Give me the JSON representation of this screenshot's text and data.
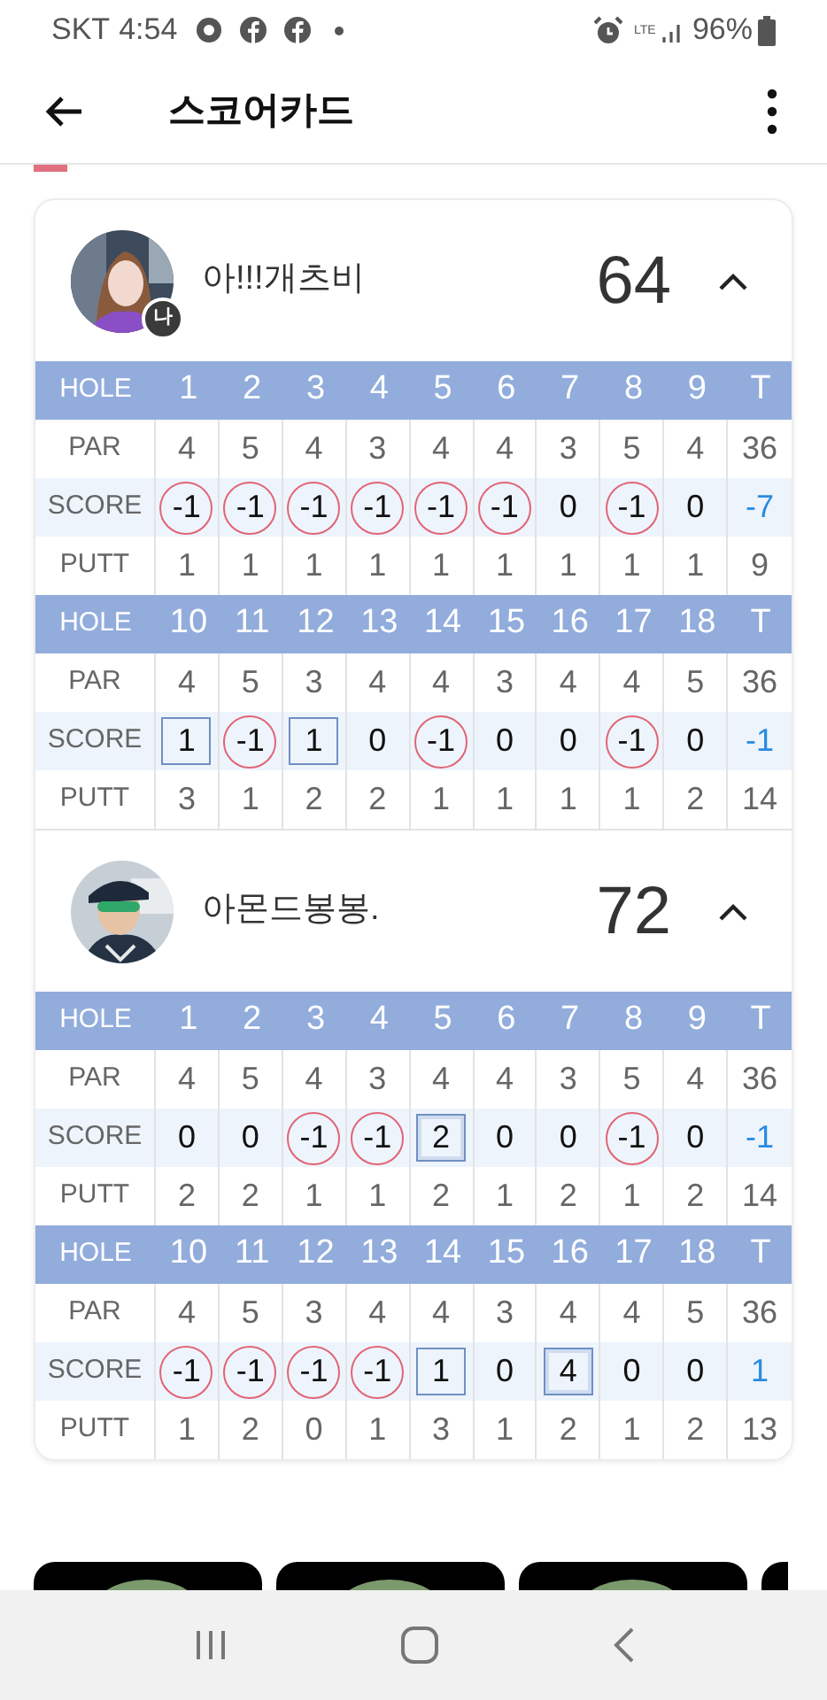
{
  "status_bar": {
    "carrier": "SKT",
    "time": "4:54",
    "network": "LTE",
    "battery": "96%"
  },
  "app_bar": {
    "title": "스코어카드"
  },
  "players": [
    {
      "name": "아!!!개츠비",
      "total": "64",
      "badge": "나",
      "expanded": true,
      "nines": [
        {
          "labels": [
            "HOLE",
            "PAR",
            "SCORE",
            "PUTT"
          ],
          "holes": [
            "1",
            "2",
            "3",
            "4",
            "5",
            "6",
            "7",
            "8",
            "9",
            "T"
          ],
          "par": [
            "4",
            "5",
            "4",
            "3",
            "4",
            "4",
            "3",
            "5",
            "4",
            "36"
          ],
          "scores": [
            {
              "value": "-1",
              "kind": "circle"
            },
            {
              "value": "-1",
              "kind": "circle"
            },
            {
              "value": "-1",
              "kind": "circle"
            },
            {
              "value": "-1",
              "kind": "circle"
            },
            {
              "value": "-1",
              "kind": "circle"
            },
            {
              "value": "-1",
              "kind": "circle"
            },
            {
              "value": "0",
              "kind": "plain"
            },
            {
              "value": "-1",
              "kind": "circle"
            },
            {
              "value": "0",
              "kind": "plain"
            }
          ],
          "score_total": "-7",
          "putt": [
            "1",
            "1",
            "1",
            "1",
            "1",
            "1",
            "1",
            "1",
            "1",
            "9"
          ]
        },
        {
          "labels": [
            "HOLE",
            "PAR",
            "SCORE",
            "PUTT"
          ],
          "holes": [
            "10",
            "11",
            "12",
            "13",
            "14",
            "15",
            "16",
            "17",
            "18",
            "T"
          ],
          "par": [
            "4",
            "5",
            "3",
            "4",
            "4",
            "3",
            "4",
            "4",
            "5",
            "36"
          ],
          "scores": [
            {
              "value": "1",
              "kind": "box"
            },
            {
              "value": "-1",
              "kind": "circle"
            },
            {
              "value": "1",
              "kind": "box"
            },
            {
              "value": "0",
              "kind": "plain"
            },
            {
              "value": "-1",
              "kind": "circle"
            },
            {
              "value": "0",
              "kind": "plain"
            },
            {
              "value": "0",
              "kind": "plain"
            },
            {
              "value": "-1",
              "kind": "circle"
            },
            {
              "value": "0",
              "kind": "plain"
            }
          ],
          "score_total": "-1",
          "putt": [
            "3",
            "1",
            "2",
            "2",
            "1",
            "1",
            "1",
            "1",
            "2",
            "14"
          ]
        }
      ]
    },
    {
      "name": "아몬드봉봉.",
      "total": "72",
      "expanded": true,
      "nines": [
        {
          "labels": [
            "HOLE",
            "PAR",
            "SCORE",
            "PUTT"
          ],
          "holes": [
            "1",
            "2",
            "3",
            "4",
            "5",
            "6",
            "7",
            "8",
            "9",
            "T"
          ],
          "par": [
            "4",
            "5",
            "4",
            "3",
            "4",
            "4",
            "3",
            "5",
            "4",
            "36"
          ],
          "scores": [
            {
              "value": "0",
              "kind": "plain"
            },
            {
              "value": "0",
              "kind": "plain"
            },
            {
              "value": "-1",
              "kind": "circle"
            },
            {
              "value": "-1",
              "kind": "circle"
            },
            {
              "value": "2",
              "kind": "double_box"
            },
            {
              "value": "0",
              "kind": "plain"
            },
            {
              "value": "0",
              "kind": "plain"
            },
            {
              "value": "-1",
              "kind": "circle"
            },
            {
              "value": "0",
              "kind": "plain"
            }
          ],
          "score_total": "-1",
          "putt": [
            "2",
            "2",
            "1",
            "1",
            "2",
            "1",
            "2",
            "1",
            "2",
            "14"
          ]
        },
        {
          "labels": [
            "HOLE",
            "PAR",
            "SCORE",
            "PUTT"
          ],
          "holes": [
            "10",
            "11",
            "12",
            "13",
            "14",
            "15",
            "16",
            "17",
            "18",
            "T"
          ],
          "par": [
            "4",
            "5",
            "3",
            "4",
            "4",
            "3",
            "4",
            "4",
            "5",
            "36"
          ],
          "scores": [
            {
              "value": "-1",
              "kind": "circle"
            },
            {
              "value": "-1",
              "kind": "circle"
            },
            {
              "value": "-1",
              "kind": "circle"
            },
            {
              "value": "-1",
              "kind": "circle"
            },
            {
              "value": "1",
              "kind": "box"
            },
            {
              "value": "0",
              "kind": "plain"
            },
            {
              "value": "4",
              "kind": "double_box"
            },
            {
              "value": "0",
              "kind": "plain"
            },
            {
              "value": "0",
              "kind": "plain"
            }
          ],
          "score_total": "1",
          "putt": [
            "1",
            "2",
            "0",
            "1",
            "3",
            "1",
            "2",
            "1",
            "2",
            "13"
          ]
        }
      ]
    }
  ]
}
